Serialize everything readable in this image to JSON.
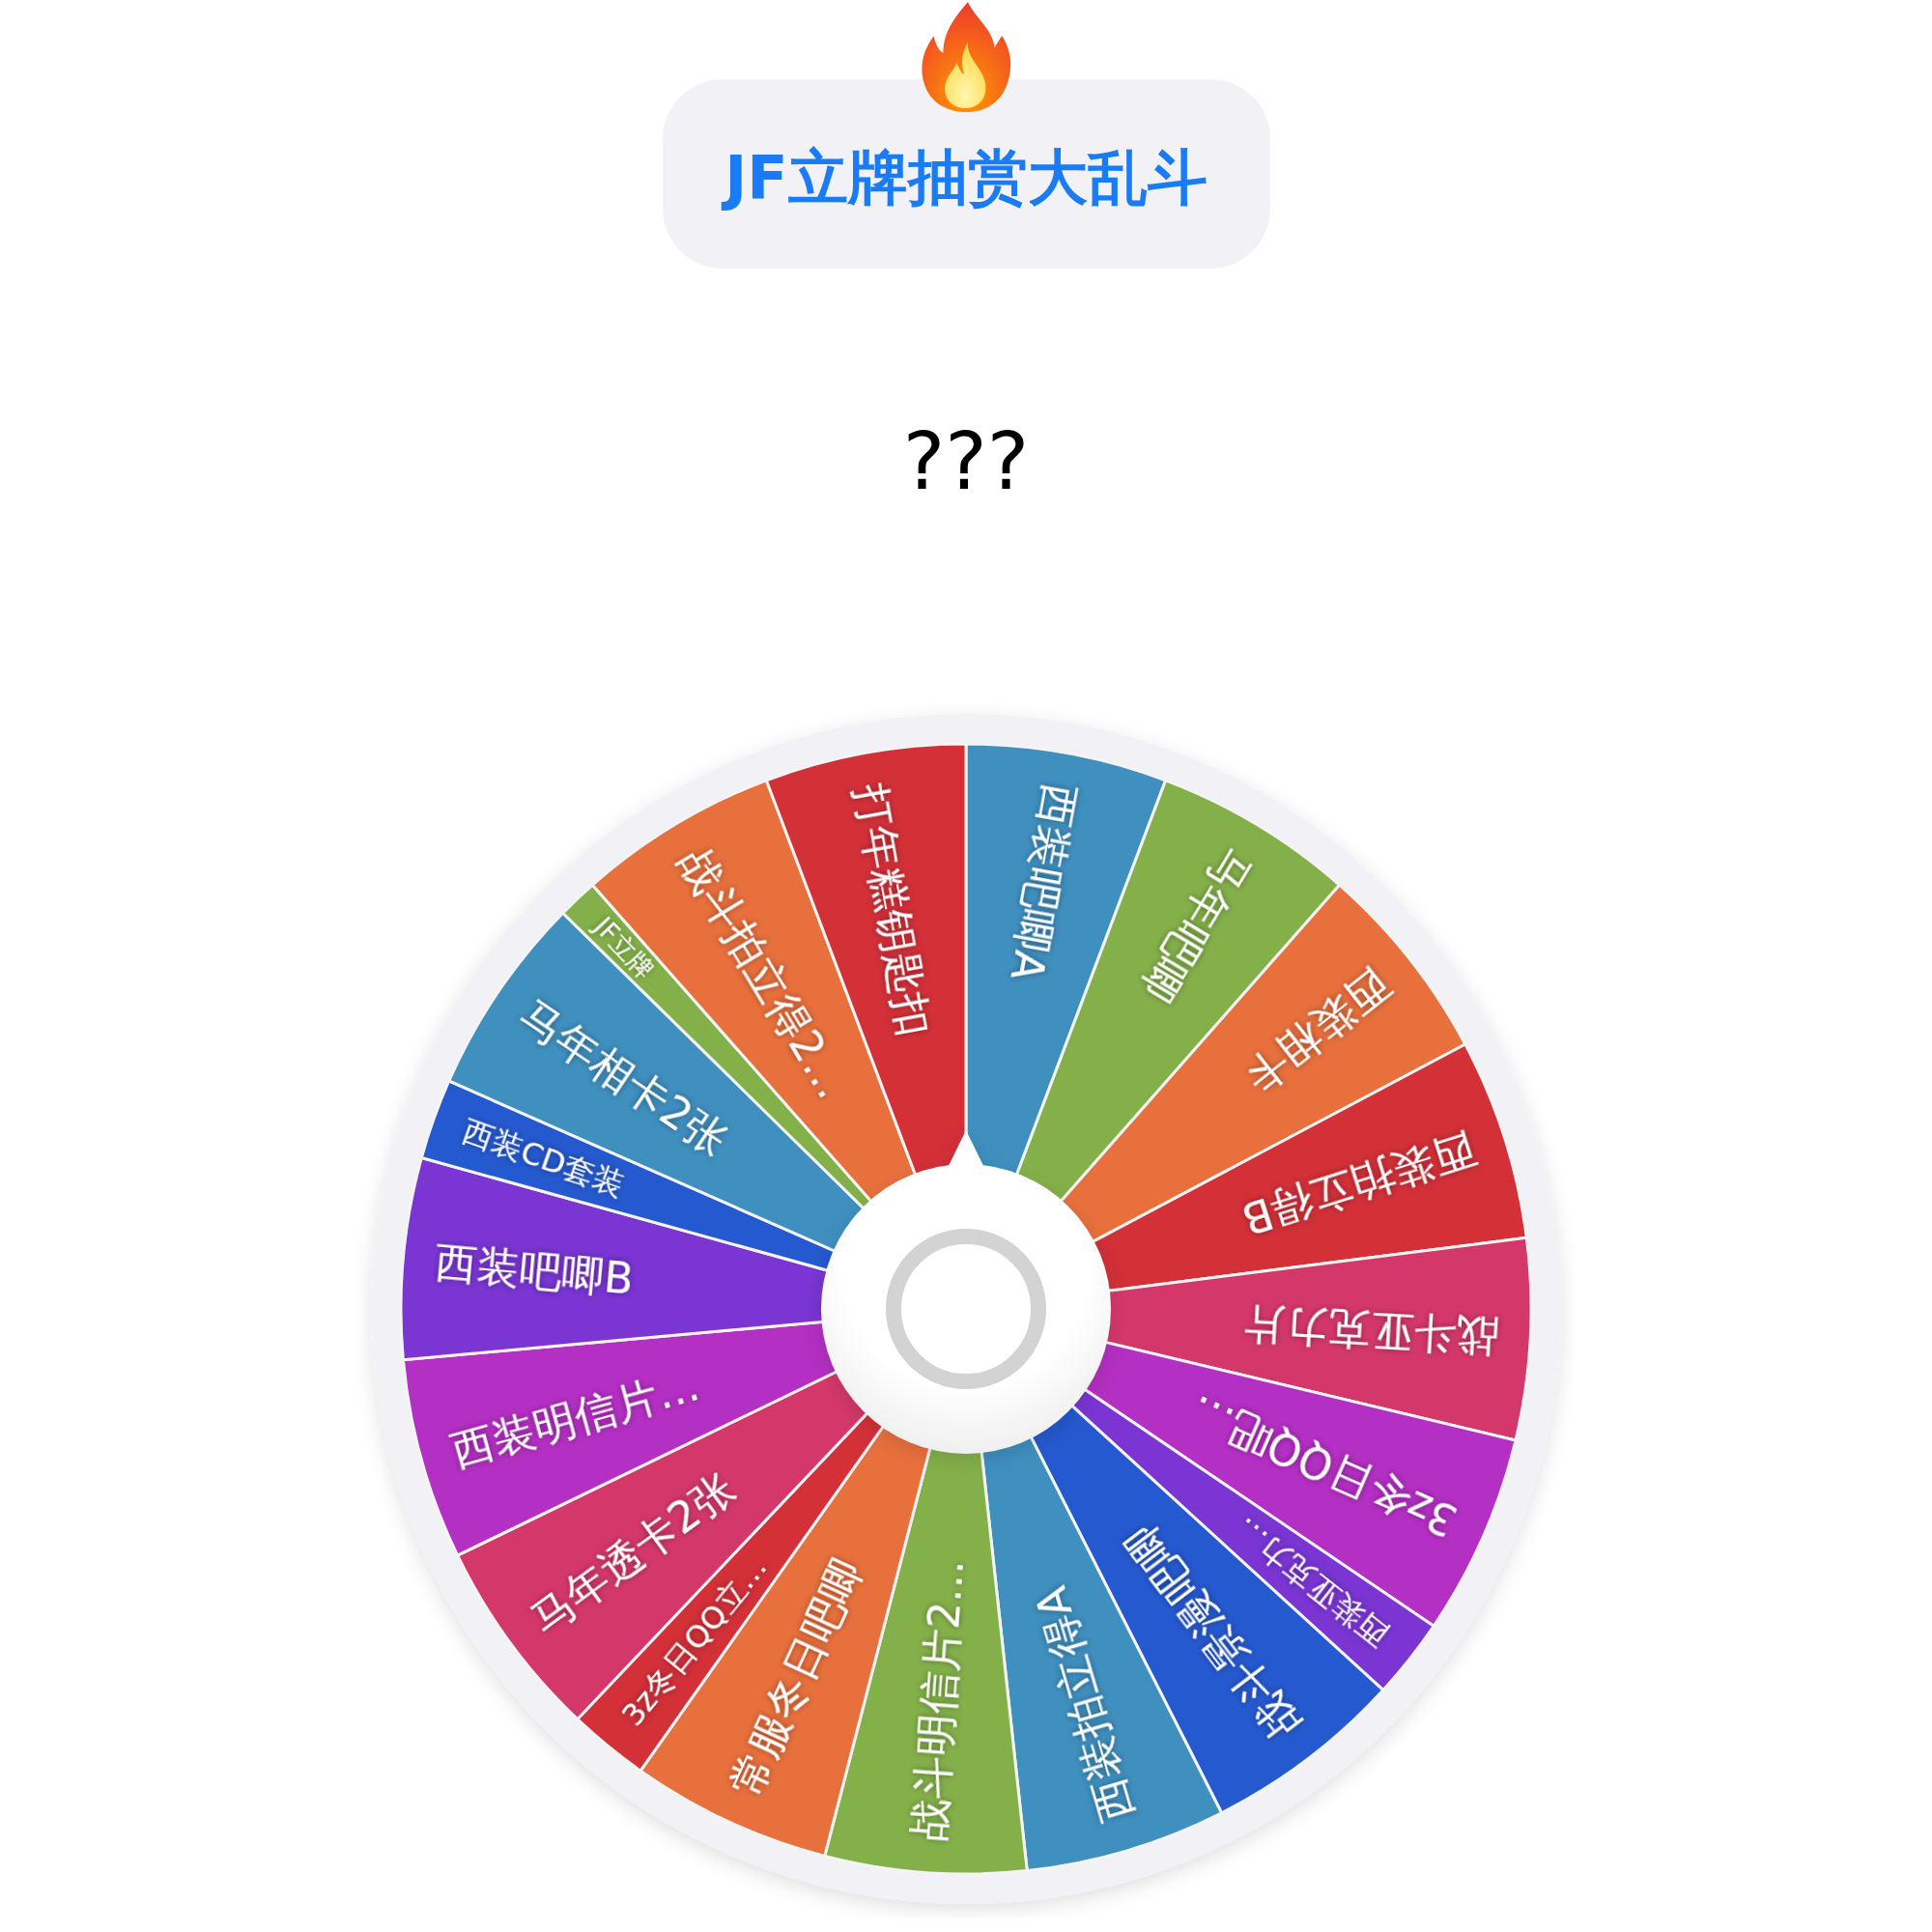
{
  "title": "JF立牌抽赏大乱斗",
  "result": "???",
  "wheel": {
    "segments": [
      {
        "label": "西装吧唧A",
        "color": "#3f8fbf",
        "kind": "wide"
      },
      {
        "label": "马年吧唧",
        "color": "#84b04a",
        "kind": "wide"
      },
      {
        "label": "西装相卡",
        "color": "#e8703d",
        "kind": "wide"
      },
      {
        "label": "西装拍立得B",
        "color": "#d33038",
        "kind": "wide"
      },
      {
        "label": "战斗亚克力片",
        "color": "#d4386a",
        "kind": "wide"
      },
      {
        "label": "3z冬日QQ吧…",
        "color": "#b42fc3",
        "kind": "wide"
      },
      {
        "label": "西装亚克力…",
        "color": "#7a35d3",
        "kind": "narrow"
      },
      {
        "label": "战斗景漫吧唧",
        "color": "#2559cf",
        "kind": "wide"
      },
      {
        "label": "西装拍立得A",
        "color": "#3f8fbf",
        "kind": "wide"
      },
      {
        "label": "战斗明信片2…",
        "color": "#84b04a",
        "kind": "wide"
      },
      {
        "label": "常服冬日吧唧",
        "color": "#e8703d",
        "kind": "wide"
      },
      {
        "label": "3z冬日QQ立…",
        "color": "#d33038",
        "kind": "narrow"
      },
      {
        "label": "马年透卡2张",
        "color": "#d4386a",
        "kind": "wide"
      },
      {
        "label": "西装明信片…",
        "color": "#b42fc3",
        "kind": "wide"
      },
      {
        "label": "西装吧唧B",
        "color": "#7a35d3",
        "kind": "wide"
      },
      {
        "label": "西装CD套装",
        "color": "#2559cf",
        "kind": "narrow"
      },
      {
        "label": "马年相卡2张",
        "color": "#3f8fbf",
        "kind": "wide"
      },
      {
        "label": "JF立牌",
        "color": "#84b04a",
        "kind": "thin"
      },
      {
        "label": "战斗拍立得2…",
        "color": "#e8703d",
        "kind": "wide"
      },
      {
        "label": "打年糕钥匙扣",
        "color": "#d33038",
        "kind": "wide"
      }
    ]
  }
}
